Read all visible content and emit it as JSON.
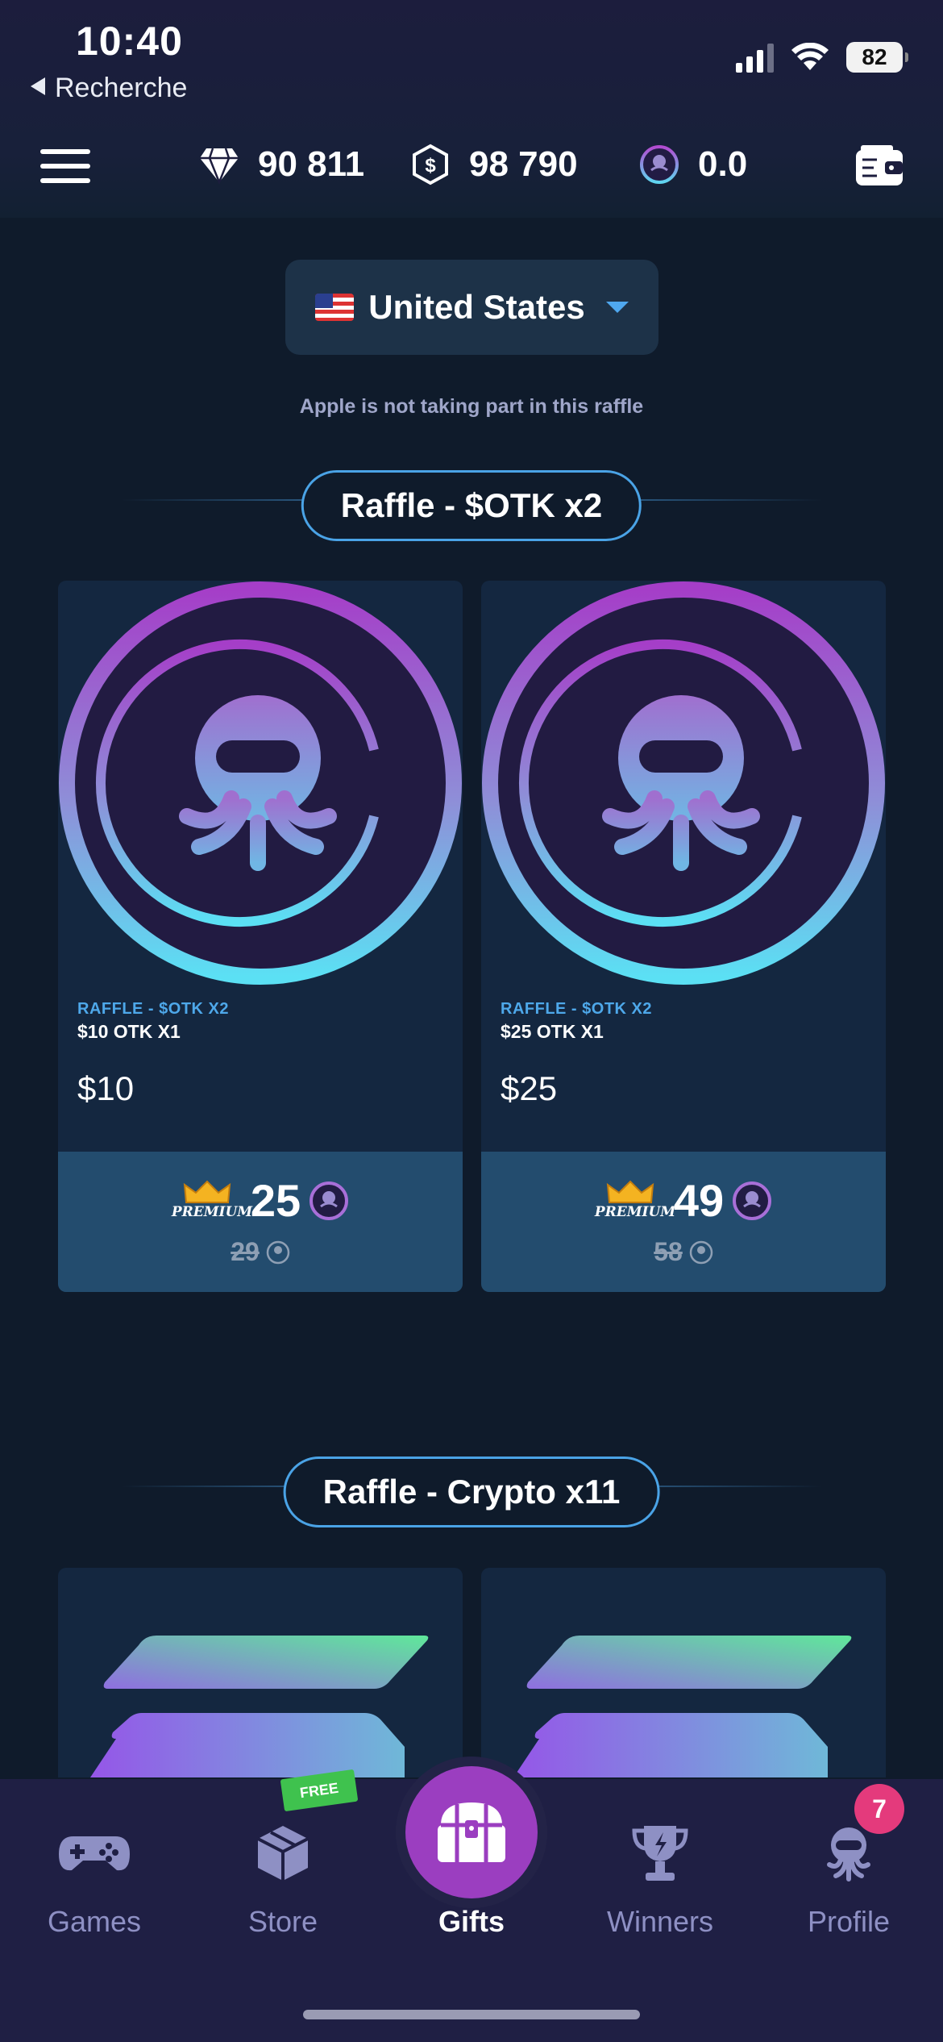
{
  "status_bar": {
    "time": "10:40",
    "back_label": "Recherche",
    "battery": "82"
  },
  "header": {
    "gems": "90 811",
    "coins": "98 790",
    "otk": "0.0"
  },
  "country": {
    "name": "United States"
  },
  "notice": "Apple is not taking part in this raffle",
  "sections": [
    {
      "title": "Raffle - $OTK x2",
      "cards": [
        {
          "subtitle": "RAFFLE - $OTK X2",
          "name": "$10 OTK X1",
          "price": "$10",
          "premium_label": "PREMIUM",
          "premium_price": "25",
          "old_price": "29"
        },
        {
          "subtitle": "RAFFLE - $OTK X2",
          "name": "$25 OTK X1",
          "price": "$25",
          "premium_label": "PREMIUM",
          "premium_price": "49",
          "old_price": "58"
        }
      ]
    },
    {
      "title": "Raffle - Crypto x11"
    }
  ],
  "nav": {
    "items": [
      {
        "label": "Games"
      },
      {
        "label": "Store",
        "tag": "FREE"
      },
      {
        "label": "Gifts"
      },
      {
        "label": "Winners"
      },
      {
        "label": "Profile",
        "badge": "7"
      }
    ]
  },
  "colors": {
    "accent_blue": "#4aa3e6",
    "gift_purple": "#9b3ec0",
    "badge_pink": "#e43a7c"
  }
}
